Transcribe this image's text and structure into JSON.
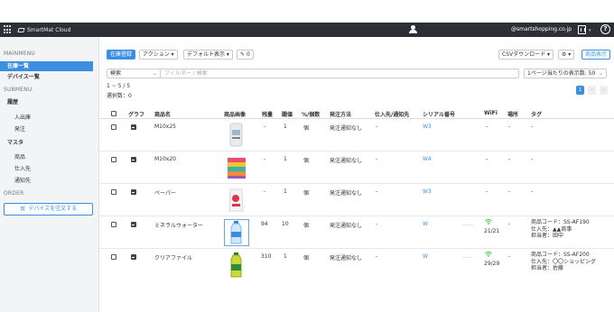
{
  "topbar": {
    "brand": "SmartMat Cloud",
    "email": "@smartshopping.co.jp"
  },
  "sidebar": {
    "mainmenu_label": "MAINMENU",
    "items_main": [
      {
        "label": "在庫一覧",
        "active": true
      },
      {
        "label": "デバイス一覧",
        "active": false
      }
    ],
    "submenu_label": "SUBMENU",
    "history_label": "履歴",
    "history_items": [
      "入出庫",
      "発注"
    ],
    "master_label": "マスタ",
    "master_items": [
      "商品",
      "仕入先",
      "通知先"
    ],
    "order_label": "ORDER",
    "order_button": "デバイスを注文する"
  },
  "toolbar": {
    "add_stock": "在庫登録",
    "action": "アクション",
    "default_view": "デフォルト表示",
    "edit_count": "0",
    "csv_download": "CSVダウンロード",
    "product_view": "商品表示"
  },
  "search": {
    "select_label": "検索",
    "filter_placeholder": "フィルター / 検索",
    "per_page_label": "1ページ当たりの表示数: 50"
  },
  "list_info": {
    "range": "1 ~ 5 / 5",
    "selected": "選択数：0"
  },
  "pagination": {
    "current": "1"
  },
  "table": {
    "headers": {
      "graph": "グラフ",
      "name": "商品名",
      "image": "商品画像",
      "remaining": "残量",
      "threshold": "閾値",
      "unit": "%/個数",
      "order_method": "発注方法",
      "supplier": "仕入先/通知先",
      "serial": "シリアル番号",
      "wifi": "WiFi",
      "place": "場所",
      "tag": "タグ"
    },
    "rows": [
      {
        "name": "M10x25",
        "remaining": "-",
        "threshold": "1",
        "unit": "個",
        "order_method": "発注通知なし",
        "supplier": "-",
        "serial": "W3",
        "dots": "",
        "wifi": "-",
        "wifi_signal": false,
        "place": "-",
        "tags": [
          "-"
        ],
        "image": "bag-white"
      },
      {
        "name": "M10x20",
        "remaining": "-",
        "threshold": "1",
        "unit": "個",
        "order_method": "発注通知なし",
        "supplier": "-",
        "serial": "W4",
        "dots": "",
        "wifi": "-",
        "wifi_signal": false,
        "place": "-",
        "tags": [
          "-"
        ],
        "image": "stack-colors"
      },
      {
        "name": "ペーパー",
        "remaining": "-",
        "threshold": "1",
        "unit": "個",
        "order_method": "発注通知なし",
        "supplier": "-",
        "serial": "W3",
        "dots": "",
        "wifi": "-",
        "wifi_signal": false,
        "place": "-",
        "tags": [
          "-"
        ],
        "image": "bag-red"
      },
      {
        "name": "ミネラルウォーター",
        "remaining": "94",
        "threshold": "10",
        "unit": "個",
        "order_method": "発注通知なし",
        "supplier": "-",
        "serial": "W",
        "dots": "……",
        "wifi": "21/21",
        "wifi_signal": true,
        "place": "-",
        "tags": [
          "商品コード：SS-AF190",
          "仕入先：▲▲商事",
          "担当者：田中"
        ],
        "image": "water-bottle"
      },
      {
        "name": "クリアファイル",
        "remaining": "310",
        "threshold": "1",
        "unit": "個",
        "order_method": "発注通知なし",
        "supplier": "-",
        "serial": "W",
        "dots": "……",
        "wifi": "29/29",
        "wifi_signal": true,
        "place": "-",
        "tags": [
          "商品コード：SS-AF200",
          "仕入先：〇〇ショッピング",
          "担当者：佐藤"
        ],
        "image": "green-bottle"
      }
    ]
  },
  "colors": {
    "topbar": "#2c2f36",
    "accent": "#3a8fe0",
    "wifi": "#2ecc40"
  }
}
